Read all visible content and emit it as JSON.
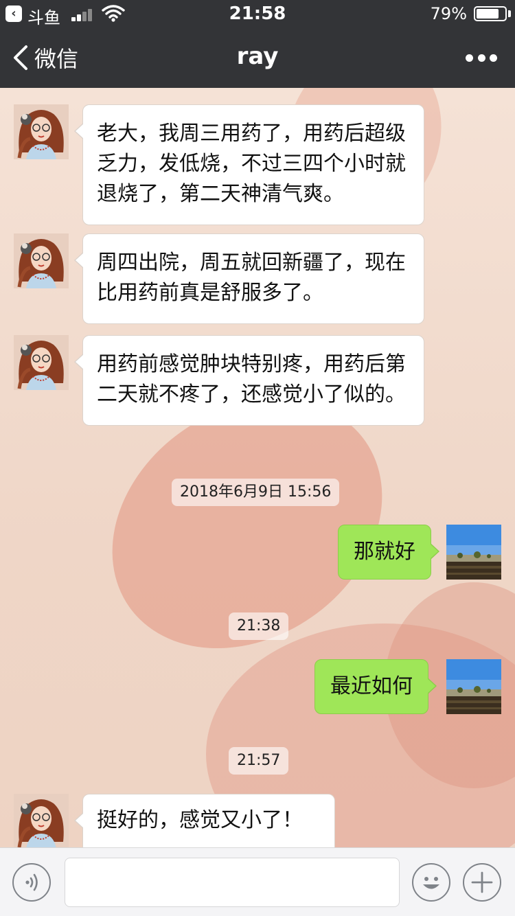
{
  "status_bar": {
    "app_name": "斗鱼",
    "time": "21:58",
    "battery_text": "79%",
    "battery_level": 0.79
  },
  "nav": {
    "back_label": "微信",
    "title": "ray"
  },
  "messages": {
    "m1": {
      "text": "老大，我周三用药了，用药后超级乏力，发低烧，不过三四个小时就退烧了，第二天神清气爽。"
    },
    "m2": {
      "text": "周四出院，周五就回新疆了，现在比用药前真是舒服多了。"
    },
    "m3": {
      "text": "用药前感觉肿块特别疼，用药后第二天就不疼了，还感觉小了似的。"
    },
    "ts1": "2018年6月9日 15:56",
    "m4": {
      "text": "那就好"
    },
    "ts2": "21:38",
    "m5": {
      "text": "最近如何"
    },
    "ts3": "21:57",
    "m6": {
      "text": "挺好的，感觉又小了！"
    }
  },
  "colors": {
    "bar": "#333437",
    "bubble_out": "#9fe658",
    "bubble_in": "#ffffff"
  },
  "icons": {
    "voice": "voice-icon",
    "emoji": "emoji-icon",
    "plus": "plus-icon",
    "more": "more-icon"
  }
}
